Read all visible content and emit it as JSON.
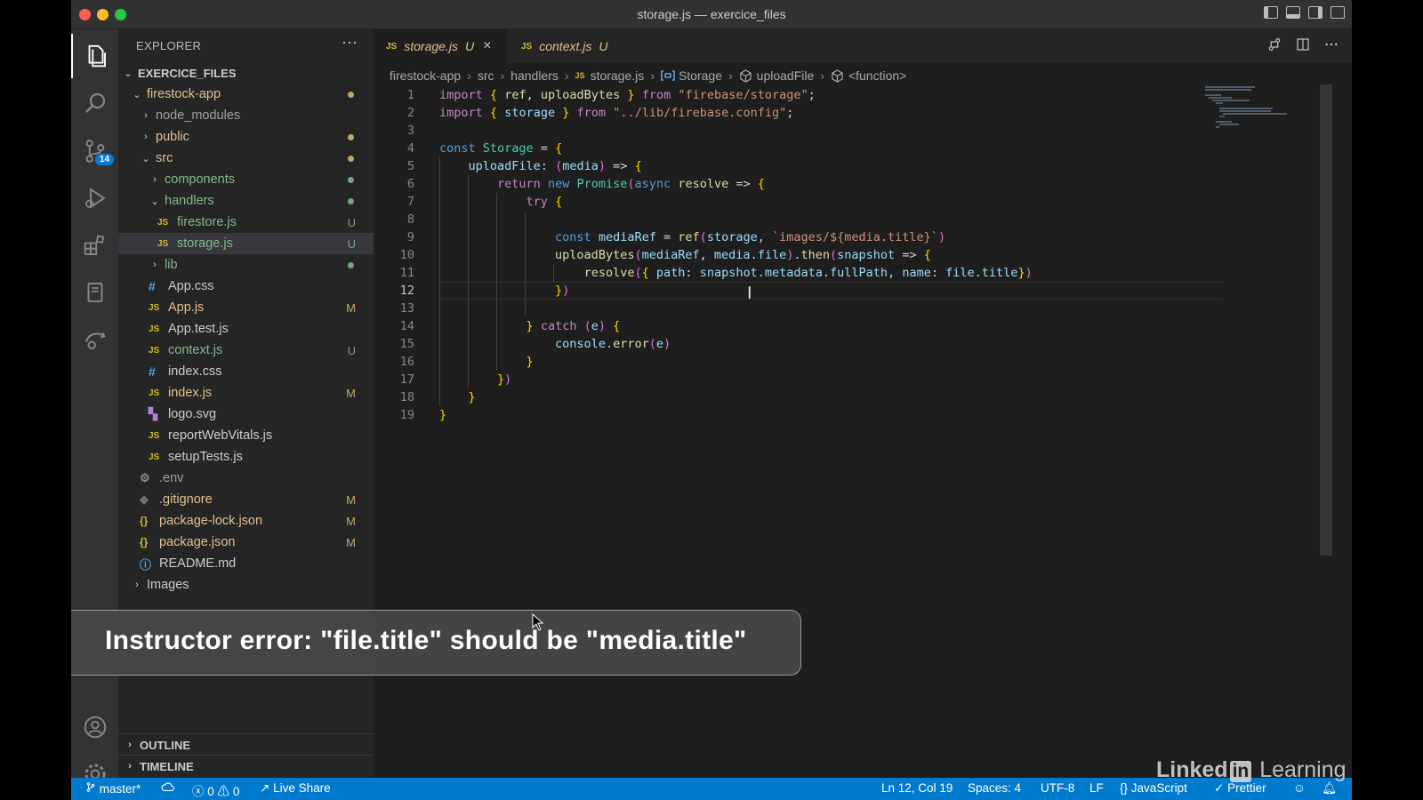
{
  "window": {
    "title": "storage.js — exercice_files"
  },
  "activity_bar": {
    "source_control_badge": "14"
  },
  "sidebar": {
    "title": "EXPLORER",
    "more": "···",
    "root": "EXERCICE_FILES",
    "items": [
      {
        "label": "firestock-app",
        "status": "",
        "icon": "folder"
      },
      {
        "label": "node_modules",
        "status": "",
        "icon": "folder"
      },
      {
        "label": "public",
        "status": "",
        "icon": "folder"
      },
      {
        "label": "src",
        "status": "",
        "icon": "folder"
      },
      {
        "label": "components",
        "status": "",
        "icon": "folder"
      },
      {
        "label": "handlers",
        "status": "",
        "icon": "folder"
      },
      {
        "label": "firestore.js",
        "status": "U",
        "icon": "js"
      },
      {
        "label": "storage.js",
        "status": "U",
        "icon": "js"
      },
      {
        "label": "lib",
        "status": "",
        "icon": "folder"
      },
      {
        "label": "App.css",
        "status": "",
        "icon": "css"
      },
      {
        "label": "App.js",
        "status": "M",
        "icon": "js"
      },
      {
        "label": "App.test.js",
        "status": "",
        "icon": "js"
      },
      {
        "label": "context.js",
        "status": "U",
        "icon": "js"
      },
      {
        "label": "index.css",
        "status": "",
        "icon": "css"
      },
      {
        "label": "index.js",
        "status": "M",
        "icon": "js"
      },
      {
        "label": "logo.svg",
        "status": "",
        "icon": "svg"
      },
      {
        "label": "reportWebVitals.js",
        "status": "",
        "icon": "js"
      },
      {
        "label": "setupTests.js",
        "status": "",
        "icon": "js"
      },
      {
        "label": ".env",
        "status": "",
        "icon": "gear"
      },
      {
        "label": ".gitignore",
        "status": "M",
        "icon": "git"
      },
      {
        "label": "package-lock.json",
        "status": "M",
        "icon": "json"
      },
      {
        "label": "package.json",
        "status": "M",
        "icon": "json"
      },
      {
        "label": "README.md",
        "status": "",
        "icon": "info"
      },
      {
        "label": "Images",
        "status": "",
        "icon": "folder"
      }
    ],
    "outline": "OUTLINE",
    "timeline": "TIMELINE"
  },
  "icons": {
    "js": "JS",
    "css": "#",
    "json": "{}",
    "svg": "▚",
    "info": "ⓘ",
    "gear": "⚙",
    "git": "◆",
    "chev_right": "›",
    "chev_down": "⌄",
    "close": "×"
  },
  "tabs": [
    {
      "label": "storage.js",
      "status": "U",
      "active": true
    },
    {
      "label": "context.js",
      "status": "U",
      "active": false
    }
  ],
  "breadcrumbs": [
    "firestock-app",
    "src",
    "handlers",
    "storage.js",
    "Storage",
    "uploadFile",
    "<function>"
  ],
  "code": {
    "current_line": 12,
    "lines": [
      "import { ref, uploadBytes } from \"firebase/storage\";",
      "import { storage } from \"../lib/firebase.config\";",
      "",
      "const Storage = {",
      "    uploadFile: (media) => {",
      "        return new Promise(async resolve => {",
      "            try {",
      "",
      "                const mediaRef = ref(storage, `images/${media.title}`)",
      "                uploadBytes(mediaRef, media.file).then(snapshot => {",
      "                    resolve({ path: snapshot.metadata.fullPath, name: file.title})",
      "                })",
      "",
      "            } catch (e) {",
      "                console.error(e)",
      "            }",
      "        })",
      "    }",
      "}"
    ]
  },
  "status_bar": {
    "branch": "master*",
    "errors": "0",
    "warnings": "0",
    "live_share": "Live Share",
    "position": "Ln 12, Col 19",
    "spaces": "Spaces: 4",
    "encoding": "UTF-8",
    "eol": "LF",
    "language": "JavaScript",
    "formatter": "Prettier"
  },
  "overlay": {
    "text": "Instructor error: \"file.title\" should be \"media.title\""
  },
  "watermark": {
    "brand_left": "Linked",
    "brand_in": "in",
    "brand_right": "Learning"
  },
  "colors": {
    "status_bar": "#007acc",
    "untracked": "#81b88b",
    "modified": "#e2c08d",
    "js_icon": "#d7ba27"
  }
}
